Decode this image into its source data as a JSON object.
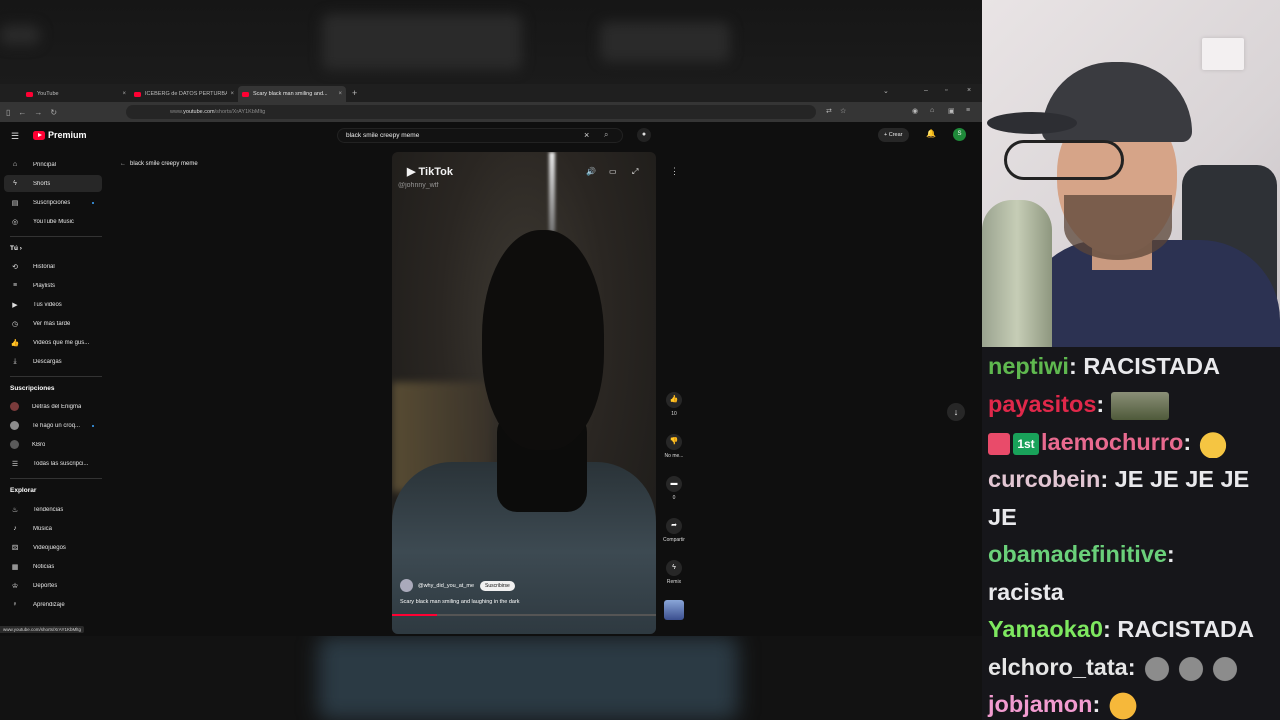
{
  "browser": {
    "tabs": [
      {
        "label": "YouTube",
        "active": false
      },
      {
        "label": "ICEBERG de DATOS PERTURBA...",
        "active": false
      },
      {
        "label": "Scary black man smiling and...",
        "active": true
      }
    ],
    "url_prefix": "www.",
    "url_host": "youtube.com",
    "url_path": "/shorts/XrAY1KbMltg",
    "status_url": "www.youtube.com/shorts/XrAY1KbMltg"
  },
  "youtube": {
    "logo_text": "Premium",
    "search_query": "black smile creepy meme",
    "create_label": "Crear",
    "avatar_letter": "S",
    "back_title": "black smile creepy meme",
    "sidebar": {
      "main": [
        {
          "label": "Principal",
          "icon": "home-icon"
        },
        {
          "label": "Shorts",
          "icon": "shorts-icon"
        },
        {
          "label": "Suscripciones",
          "icon": "subscriptions-icon"
        },
        {
          "label": "YouTube Music",
          "icon": "music-icon"
        }
      ],
      "you_heading": "Tú",
      "you": [
        {
          "label": "Historial",
          "icon": "history-icon"
        },
        {
          "label": "Playlists",
          "icon": "playlist-icon"
        },
        {
          "label": "Tus videos",
          "icon": "video-icon"
        },
        {
          "label": "Ver más tarde",
          "icon": "clock-icon"
        },
        {
          "label": "Videos que me gus...",
          "icon": "like-icon"
        },
        {
          "label": "Descargas",
          "icon": "download-icon"
        }
      ],
      "subs_heading": "Suscripciones",
      "subs": [
        {
          "label": "Detrás del Enigma"
        },
        {
          "label": "Te hago un croq..."
        },
        {
          "label": "KBro"
        },
        {
          "label": "Todas las suscripci..."
        }
      ],
      "explore_heading": "Explorar",
      "explore": [
        {
          "label": "Tendencias",
          "icon": "trending-icon"
        },
        {
          "label": "Música",
          "icon": "music-note-icon"
        },
        {
          "label": "Videojuegos",
          "icon": "gamepad-icon"
        },
        {
          "label": "Noticias",
          "icon": "news-icon"
        },
        {
          "label": "Deportes",
          "icon": "trophy-icon"
        },
        {
          "label": "Aprendizaje",
          "icon": "bulb-icon"
        }
      ]
    },
    "short": {
      "watermark": "TikTok",
      "watermark_user": "@johnny_wtf",
      "channel": "@why_did_you_at_me",
      "subscribe_label": "Suscribirse",
      "title": "Scary black man smiling and laughing in the dark",
      "progress": 0.17,
      "likes": "10",
      "dislike_label": "No me...",
      "comments": "0",
      "share_label": "Compartir",
      "remix_label": "Remix"
    }
  },
  "chat": {
    "messages": [
      {
        "user": "neptiwi",
        "color": "#5fb84f",
        "text": "RACISTADA"
      },
      {
        "user": "payasitos",
        "color": "#e0284a",
        "text": "",
        "emote": "crocodile-emote"
      },
      {
        "user": "laemochurro",
        "color": "#e86a8f",
        "badges": [
          "sword-badge",
          "1st"
        ],
        "text": "",
        "emote": "duck-emote"
      },
      {
        "user": "curcobein",
        "color": "#e2c6d3",
        "text": "JE JE JE JE"
      },
      {
        "user": "",
        "color": "#e9e9ec",
        "text": "JE"
      },
      {
        "user": "obamadefinitive",
        "color": "#6ad07a",
        "text": ""
      },
      {
        "user": "",
        "color": "#e9e9ec",
        "text": "racista"
      },
      {
        "user": "Yamaoka0",
        "color": "#7ee860",
        "text": "RACISTADA"
      },
      {
        "user": "elchoro_tata",
        "color": "#e6e6e6",
        "text": "",
        "emote": "rock-emote"
      },
      {
        "user": "jobjamon",
        "color": "#f29bd0",
        "text": "",
        "emote": "laughing-emote"
      }
    ]
  }
}
